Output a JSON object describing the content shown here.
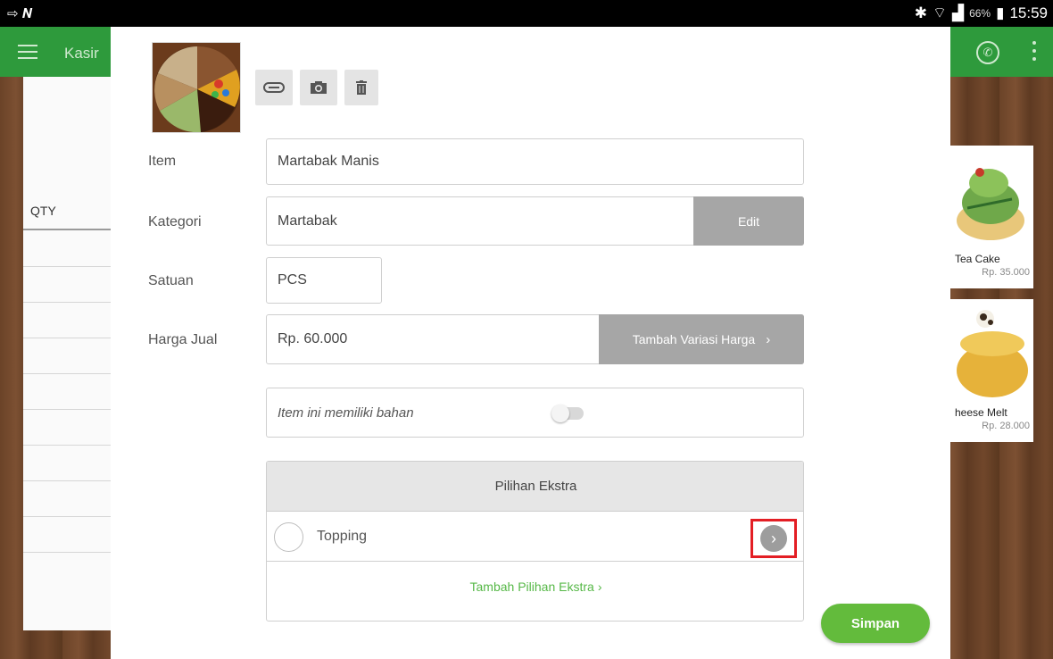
{
  "statusbar": {
    "battery": "66%",
    "time": "15:59"
  },
  "appbar": {
    "title": "Kasir"
  },
  "receipt": {
    "qty_label": "QTY"
  },
  "products": [
    {
      "name": "Tea Cake",
      "price": "Rp. 35.000"
    },
    {
      "name": "heese Melt",
      "price": "Rp. 28.000"
    }
  ],
  "dialog": {
    "labels": {
      "item": "Item",
      "kategori": "Kategori",
      "satuan": "Satuan",
      "harga_jual": "Harga Jual"
    },
    "fields": {
      "item_value": "Martabak Manis",
      "kategori_value": "Martabak",
      "satuan_value": "PCS",
      "harga_value": "Rp. 60.000",
      "bahan_label": "Item ini memiliki bahan"
    },
    "buttons": {
      "edit": "Edit",
      "tambah_variasi": "Tambah Variasi Harga",
      "tambah_pilihan": "Tambah Pilihan Ekstra",
      "simpan": "Simpan"
    },
    "toggle_on": false,
    "extras": {
      "header": "Pilihan Ekstra",
      "items": [
        {
          "label": "Topping"
        }
      ]
    }
  },
  "colors": {
    "appbar": "#2e9a3c",
    "accent_green": "#63bb3c",
    "highlight_red": "#e31e24",
    "button_gray": "#a6a6a6"
  },
  "icons": [
    "menu-icon",
    "phone-icon",
    "more-vert-icon",
    "attach-icon",
    "camera-icon",
    "trash-icon",
    "chevron-right-icon",
    "bluetooth-icon",
    "wifi-icon",
    "signal-icon",
    "battery-icon"
  ]
}
